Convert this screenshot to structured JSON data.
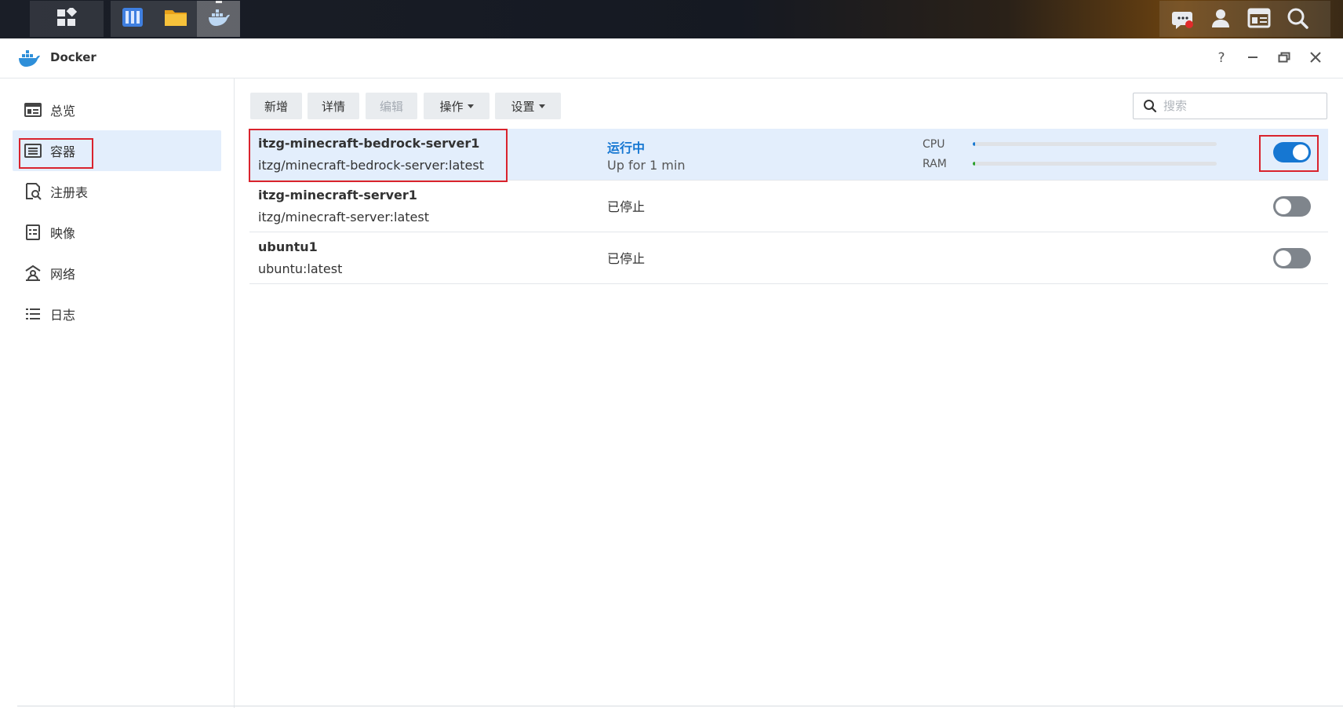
{
  "taskbar": {
    "icons": [
      "main-menu-icon",
      "storage-manager-icon",
      "file-station-icon",
      "docker-icon",
      "notification-icon",
      "user-icon",
      "widgets-icon",
      "search-icon"
    ]
  },
  "window": {
    "title": "Docker",
    "controls": [
      "?",
      "—",
      "restore",
      "✕"
    ]
  },
  "sidebar": {
    "items": [
      {
        "label": "总览",
        "icon": "overview-icon"
      },
      {
        "label": "容器",
        "icon": "container-icon",
        "selected": true
      },
      {
        "label": "注册表",
        "icon": "registry-icon"
      },
      {
        "label": "映像",
        "icon": "image-icon"
      },
      {
        "label": "网络",
        "icon": "network-icon"
      },
      {
        "label": "日志",
        "icon": "log-icon"
      }
    ]
  },
  "toolbar": {
    "add_label": "新增",
    "details_label": "详情",
    "edit_label": "编辑",
    "action_label": "操作",
    "settings_label": "设置"
  },
  "search": {
    "placeholder": "搜索"
  },
  "containers": [
    {
      "name": "itzg-minecraft-bedrock-server1",
      "image": "itzg/minecraft-bedrock-server:latest",
      "status": "运行中",
      "uptime": "Up for 1 min",
      "cpu_label": "CPU",
      "ram_label": "RAM",
      "cpu_percent": 1,
      "ram_percent": 1,
      "running": true
    },
    {
      "name": "itzg-minecraft-server1",
      "image": "itzg/minecraft-server:latest",
      "status": "已停止",
      "running": false
    },
    {
      "name": "ubuntu1",
      "image": "ubuntu:latest",
      "status": "已停止",
      "running": false
    }
  ],
  "colors": {
    "accent": "#1677d2",
    "highlight_border": "#d9232d",
    "selected_row": "#e3eefc",
    "ram_meter": "#2aa02a"
  }
}
